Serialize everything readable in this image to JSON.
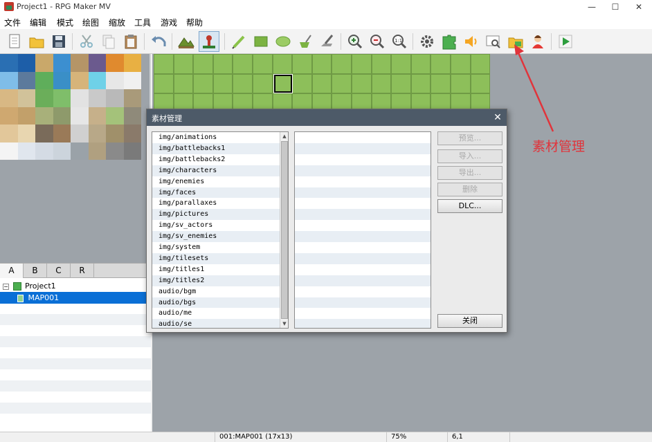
{
  "window": {
    "title": "Project1 - RPG Maker MV",
    "controls": {
      "minimize": "—",
      "maximize": "☐",
      "close": "✕"
    }
  },
  "menu": [
    "文件",
    "编辑",
    "模式",
    "绘图",
    "缩放",
    "工具",
    "游戏",
    "帮助"
  ],
  "toolbar": {
    "buttons": [
      "new-project-icon",
      "open-project-icon",
      "save-project-icon",
      "cut-icon",
      "copy-icon",
      "paste-icon",
      "undo-icon",
      "map-mode-icon",
      "event-mode-icon",
      "pencil-icon",
      "rectangle-icon",
      "ellipse-icon",
      "fill-icon",
      "shadow-pen-icon",
      "zoom-in-icon",
      "zoom-out-icon",
      "actual-size-icon",
      "database-icon",
      "plugin-manager-icon",
      "sound-test-icon",
      "event-searcher-icon",
      "resource-manager-icon",
      "character-generator-icon",
      "playtest-icon"
    ]
  },
  "palette": {
    "tabs": [
      "A",
      "B",
      "C",
      "R"
    ],
    "active_tab": "A"
  },
  "map_tree": {
    "root": "Project1",
    "maps": [
      "MAP001"
    ]
  },
  "dialog": {
    "title": "素材管理",
    "folders": [
      "img/animations",
      "img/battlebacks1",
      "img/battlebacks2",
      "img/characters",
      "img/enemies",
      "img/faces",
      "img/parallaxes",
      "img/pictures",
      "img/sv_actors",
      "img/sv_enemies",
      "img/system",
      "img/tilesets",
      "img/titles1",
      "img/titles2",
      "audio/bgm",
      "audio/bgs",
      "audio/me",
      "audio/se"
    ],
    "buttons": {
      "preview": "预览...",
      "import": "导入...",
      "export": "导出...",
      "delete": "删除",
      "dlc": "DLC...",
      "close": "关闭"
    }
  },
  "annotation": {
    "label": "素材管理",
    "color": "#e1343b"
  },
  "status": {
    "map": "001:MAP001 (17x13)",
    "zoom": "75%",
    "coords": "6,1"
  },
  "colors": {
    "grass": "#8dbf5a",
    "selection": "#0a6fd6",
    "dialog_title": "#4d5a68",
    "workspace": "#9da3a9"
  }
}
